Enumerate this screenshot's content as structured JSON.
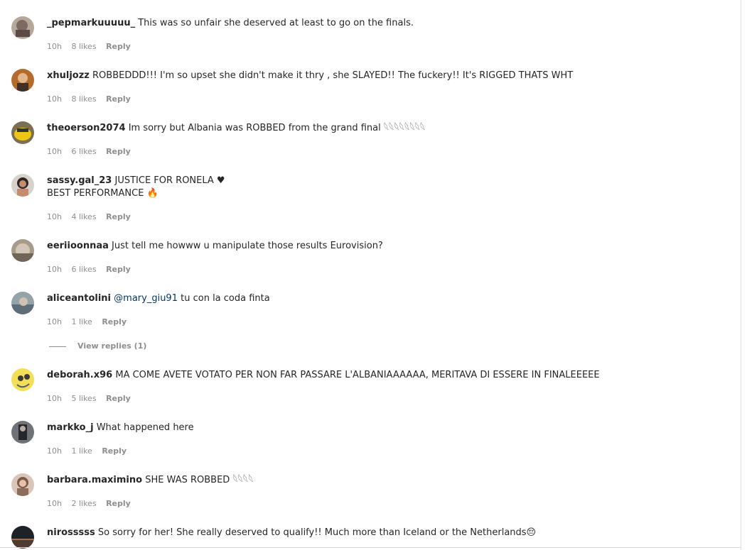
{
  "comments": [
    {
      "username": "_pepmarkuuuuu_",
      "text": "This was so unfair she deserved at least to go on the finals.",
      "time": "10h",
      "likes": "8 likes",
      "reply_label": "Reply"
    },
    {
      "username": "xhuljozz",
      "text": "ROBBEDDD!!! I'm so upset she didn't make it thry , she SLAYED!! The fuckery!! It's RIGGED THATS WHT",
      "time": "10h",
      "likes": "8 likes",
      "reply_label": "Reply"
    },
    {
      "username": "theoerson2074",
      "text": "Im sorry but Albania was ROBBED from the grand final 𓆩𓆩𓆩𓆩𓆩𓆩𓆩𓆩",
      "time": "10h",
      "likes": "6 likes",
      "reply_label": "Reply"
    },
    {
      "username": "sassy.gal_23",
      "text": "JUSTICE FOR RONELA ♥",
      "text_line2": "BEST PERFORMANCE 🔥",
      "time": "10h",
      "likes": "4 likes",
      "reply_label": "Reply"
    },
    {
      "username": "eeriioonnaa",
      "text": "Just tell me howww u manipulate those results Eurovision?",
      "time": "10h",
      "likes": "6 likes",
      "reply_label": "Reply"
    },
    {
      "username": "aliceantolini",
      "mention": "@mary_giu91",
      "text": "tu con la coda finta",
      "time": "10h",
      "likes": "1 like",
      "reply_label": "Reply",
      "view_replies": "View replies (1)"
    },
    {
      "username": "deborah.x96",
      "text": "MA COME AVETE VOTATO PER NON FAR PASSARE L'ALBANIAAAAAA, MERITAVA DI ESSERE IN FINALEEEEE",
      "time": "10h",
      "likes": "5 likes",
      "reply_label": "Reply"
    },
    {
      "username": "markko_j",
      "text": "What happened here",
      "time": "10h",
      "likes": "1 like",
      "reply_label": "Reply"
    },
    {
      "username": "barbara.maximino",
      "text": "SHE WAS ROBBED 𓆩𓆩𓆩𓆩",
      "time": "10h",
      "likes": "2 likes",
      "reply_label": "Reply"
    },
    {
      "username": "nirosssss",
      "text": "So sorry for her! She really deserved to qualify!! Much more than Iceland or the Netherlands😔",
      "time": "",
      "likes": "",
      "reply_label": ""
    }
  ],
  "colors": {
    "text": "#262626",
    "meta": "#8e8e8e",
    "mention": "#00376b"
  }
}
